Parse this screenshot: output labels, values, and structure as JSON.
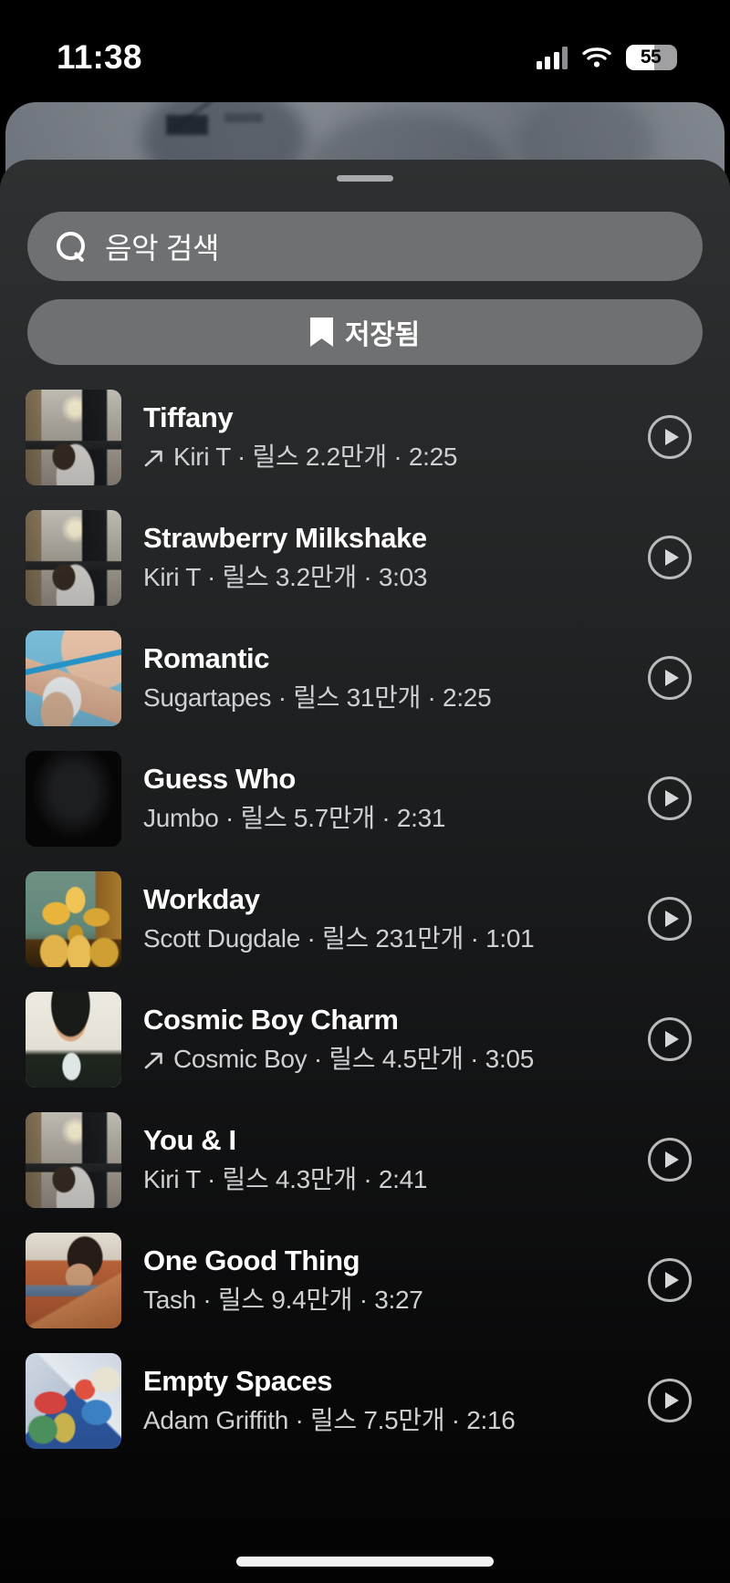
{
  "status_bar": {
    "time": "11:38",
    "battery_level": "55",
    "battery_percent": 55,
    "signal_icon": "cellular-signal-icon",
    "wifi_icon": "wifi-icon",
    "battery_icon": "battery-icon"
  },
  "sheet": {
    "grabber_name": "sheet-drag-handle"
  },
  "search": {
    "placeholder": "음악 검색",
    "value": "",
    "icon": "search-icon"
  },
  "saved_button": {
    "label": "저장됨",
    "icon": "bookmark-icon"
  },
  "list": {
    "play_icon": "play-circle-icon",
    "trending_icon": "trending-arrow-icon",
    "tracks": [
      {
        "title": "Tiffany",
        "subtitle": "Kiri T · 릴스 2.2만개 · 2:25",
        "artist": "Kiri T",
        "reels": "릴스 2.2만개",
        "duration": "2:25",
        "trending": true,
        "thumb": "desk-room-woman"
      },
      {
        "title": "Strawberry Milkshake",
        "subtitle": "Kiri T · 릴스 3.2만개 · 3:03",
        "artist": "Kiri T",
        "reels": "릴스 3.2만개",
        "duration": "3:03",
        "trending": false,
        "thumb": "desk-room-woman"
      },
      {
        "title": "Romantic",
        "subtitle": "Sugartapes · 릴스 31만개 · 2:25",
        "artist": "Sugartapes",
        "reels": "릴스 31만개",
        "duration": "2:25",
        "trending": false,
        "thumb": "blue-drink"
      },
      {
        "title": "Guess Who",
        "subtitle": "Jumbo · 릴스 5.7만개 · 2:31",
        "artist": "Jumbo",
        "reels": "릴스 5.7만개",
        "duration": "2:31",
        "trending": false,
        "thumb": "black"
      },
      {
        "title": "Workday",
        "subtitle": "Scott Dugdale · 릴스 231만개 · 1:01",
        "artist": "Scott Dugdale",
        "reels": "릴스 231만개",
        "duration": "1:01",
        "trending": false,
        "thumb": "gold-trophies"
      },
      {
        "title": "Cosmic Boy Charm",
        "subtitle": "Cosmic Boy · 릴스 4.5만개 · 3:05",
        "artist": "Cosmic Boy",
        "reels": "릴스 4.5만개",
        "duration": "3:05",
        "trending": true,
        "thumb": "portrait-man"
      },
      {
        "title": "You & I",
        "subtitle": "Kiri T · 릴스 4.3만개 · 2:41",
        "artist": "Kiri T",
        "reels": "릴스 4.3만개",
        "duration": "2:41",
        "trending": false,
        "thumb": "desk-room-woman"
      },
      {
        "title": "One Good Thing",
        "subtitle": "Tash · 릴스 9.4만개 · 3:27",
        "artist": "Tash",
        "reels": "릴스 9.4만개",
        "duration": "3:27",
        "trending": false,
        "thumb": "orange-couch"
      },
      {
        "title": "Empty Spaces",
        "subtitle": "Adam Griffith · 릴스 7.5만개 · 2:16",
        "artist": "Adam Griffith",
        "reels": "릴스 7.5만개",
        "duration": "2:16",
        "trending": false,
        "thumb": "isometric-room"
      }
    ]
  },
  "colors": {
    "sheet_top": "#2e3031",
    "field": "#6e7072",
    "title_text": "#ffffff",
    "subtitle_text": "#cfd0d1",
    "play_outline": "#b9babb",
    "home_indicator": "#f2f2f2"
  }
}
